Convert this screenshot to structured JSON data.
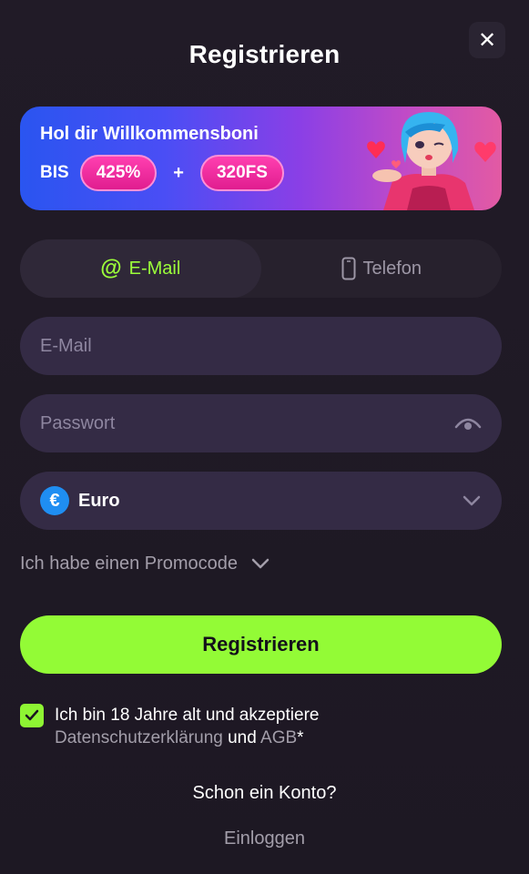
{
  "modal": {
    "title": "Registrieren",
    "close_glyph": "✕"
  },
  "banner": {
    "headline": "Hol dir Willkommensboni",
    "prefix": "BIS",
    "bonus_percent": "425%",
    "plus": "+",
    "free_spins": "320FS"
  },
  "tabs": [
    {
      "label": "E-Mail",
      "icon": "at-icon",
      "active": true
    },
    {
      "label": "Telefon",
      "icon": "phone-icon",
      "active": false
    }
  ],
  "form": {
    "email_placeholder": "E-Mail",
    "password_placeholder": "Passwort",
    "currency_symbol": "€",
    "currency_label": "Euro",
    "promo_label": "Ich habe einen Promocode",
    "submit_label": "Registrieren"
  },
  "consent": {
    "text_line1": "Ich bin 18 Jahre alt und akzeptiere",
    "privacy_link": "Datenschutzerklärung",
    "and": "und",
    "terms_link": "AGB",
    "asterisk": "*",
    "checked": true
  },
  "footer": {
    "question": "Schon ein Konto?",
    "login_link": "Einloggen"
  },
  "colors": {
    "accent_green": "#93fb36",
    "background": "#1e1923",
    "input_bg": "#342b45",
    "pill_pink": "#e01d8f"
  }
}
